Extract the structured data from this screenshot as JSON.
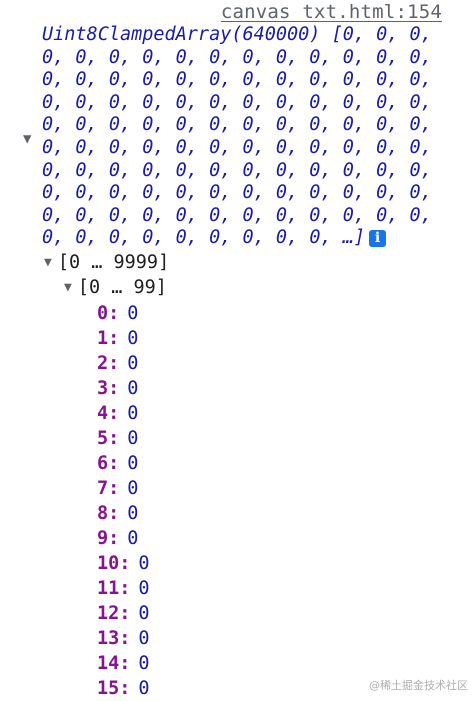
{
  "source_link": "canvas txt.html:154",
  "array_preview": {
    "type_label": "Uint8ClampedArray(640000)",
    "open_bracket": "[",
    "zero": "0",
    "ellipsis_close": "0, …]"
  },
  "info_badge": "i",
  "groups": {
    "outer_label": "[0 … 9999]",
    "inner_label": "[0 … 99]"
  },
  "entries": [
    {
      "key": "0",
      "value": "0"
    },
    {
      "key": "1",
      "value": "0"
    },
    {
      "key": "2",
      "value": "0"
    },
    {
      "key": "3",
      "value": "0"
    },
    {
      "key": "4",
      "value": "0"
    },
    {
      "key": "5",
      "value": "0"
    },
    {
      "key": "6",
      "value": "0"
    },
    {
      "key": "7",
      "value": "0"
    },
    {
      "key": "8",
      "value": "0"
    },
    {
      "key": "9",
      "value": "0"
    },
    {
      "key": "10",
      "value": "0"
    },
    {
      "key": "11",
      "value": "0"
    },
    {
      "key": "12",
      "value": "0"
    },
    {
      "key": "13",
      "value": "0"
    },
    {
      "key": "14",
      "value": "0"
    },
    {
      "key": "15",
      "value": "0"
    }
  ],
  "watermark": "@稀土掘金技术社区",
  "icons": {
    "expand_collapse": "disclosure-triangle-down-icon",
    "info": "info-icon"
  },
  "colors": {
    "key": "#881391",
    "number": "#1a1aa6",
    "info_badge": "#1a73e8",
    "link": "#5f6368"
  }
}
